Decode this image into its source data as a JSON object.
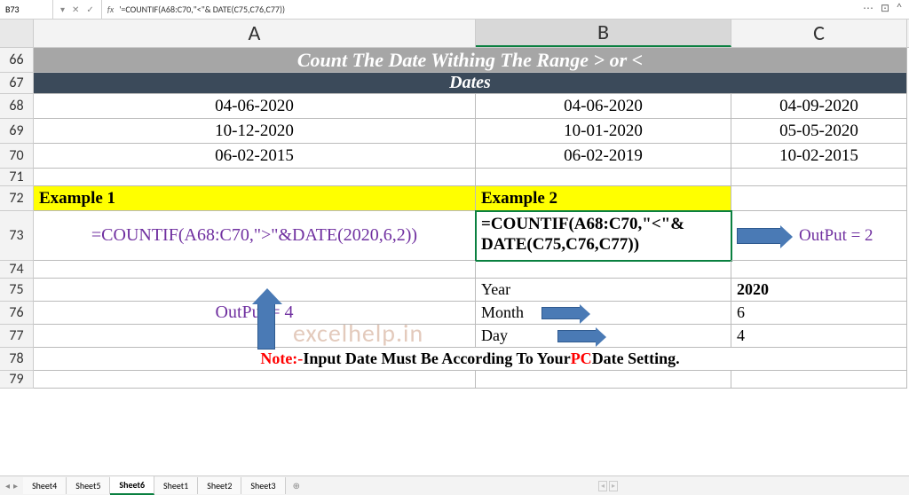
{
  "formulaBar": {
    "nameBox": "B73",
    "formula": "'=COUNTIF(A68:C70,\"<\"& DATE(C75,C76,C77))"
  },
  "columns": {
    "a": "A",
    "b": "B",
    "c": "C"
  },
  "rowNums": {
    "r66": "66",
    "r67": "67",
    "r68": "68",
    "r69": "69",
    "r70": "70",
    "r71": "71",
    "r72": "72",
    "r73": "73",
    "r74": "74",
    "r75": "75",
    "r76": "76",
    "r77": "77",
    "r78": "78",
    "r79": "79"
  },
  "cells": {
    "title": "Count The Date Withing The Range > or <",
    "datesHeader": "Dates",
    "a68": "04-06-2020",
    "b68": "04-06-2020",
    "c68": "04-09-2020",
    "a69": "10-12-2020",
    "b69": "10-01-2020",
    "c69": "05-05-2020",
    "a70": "06-02-2015",
    "b70": "06-02-2019",
    "c70": "10-02-2015",
    "a72": "Example 1",
    "b72": "Example 2",
    "a73": "=COUNTIF(A68:C70,\">\"&DATE(2020,6,2))",
    "b73": "=COUNTIF(A68:C70,\"<\"& DATE(C75,C76,C77))",
    "c73": "OutPut  =  2",
    "b75": "Year",
    "c75": "2020",
    "a76": "OutPut  =  4",
    "b76": "Month",
    "c76": "6",
    "b77": "Day",
    "c77": "4",
    "noteLabel": "Note:- ",
    "noteMid": "Input Date Must Be According To Your ",
    "notePC": "PC",
    "noteEnd": " Date Setting."
  },
  "watermark": "excelhelp.in",
  "tabs": [
    "Sheet4",
    "Sheet5",
    "Sheet6",
    "Sheet1",
    "Sheet2",
    "Sheet3"
  ],
  "activeTab": "Sheet6"
}
